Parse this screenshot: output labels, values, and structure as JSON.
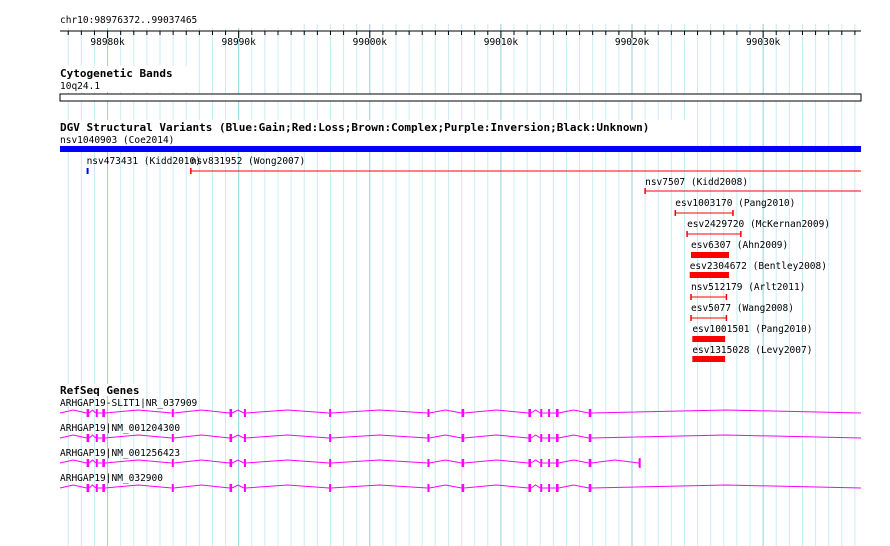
{
  "ruler": {
    "title": "chr10:98976372..99037465",
    "ticks": [
      {
        "label": "98980k",
        "pos": 98980000
      },
      {
        "label": "98990k",
        "pos": 98990000
      },
      {
        "label": "99000k",
        "pos": 99000000
      },
      {
        "label": "99010k",
        "pos": 99010000
      },
      {
        "label": "99020k",
        "pos": 99020000
      },
      {
        "label": "99030k",
        "pos": 99030000
      }
    ]
  },
  "cytoband": {
    "title": "Cytogenetic Bands",
    "band": "10q24.1"
  },
  "dgv": {
    "title": "DGV Structural Variants (Blue:Gain;Red:Loss;Brown:Complex;Purple:Inversion;Black:Unknown)",
    "colors": {
      "gain": "#0000ff",
      "loss": "#ff0000",
      "complex": "#996633",
      "inversion": "#9900cc",
      "unknown": "#000000"
    },
    "variants": [
      {
        "label": "nsv1040903 (Coe2014)",
        "type": "gain",
        "start": 98976372,
        "end": 99037465,
        "style": "block"
      },
      {
        "label": "nsv473431 (Kidd2010)",
        "type": "gain",
        "start": 98978400,
        "end": 98978550,
        "style": "tick"
      },
      {
        "label": "nsv831952 (Wong2007)",
        "type": "loss",
        "start": 98986350,
        "end": 99037465,
        "style": "line"
      },
      {
        "label": "nsv7507 (Kidd2008)",
        "type": "loss",
        "start": 99021000,
        "end": 99037465,
        "style": "line"
      },
      {
        "label": "esv1003170 (Pang2010)",
        "type": "loss",
        "start": 99023300,
        "end": 99027700,
        "style": "line"
      },
      {
        "label": "esv2429720 (McKernan2009)",
        "type": "loss",
        "start": 99024200,
        "end": 99028300,
        "style": "line"
      },
      {
        "label": "esv6307 (Ahn2009)",
        "type": "loss",
        "start": 99024500,
        "end": 99027400,
        "style": "block"
      },
      {
        "label": "esv2304672 (Bentley2008)",
        "type": "loss",
        "start": 99024400,
        "end": 99027400,
        "style": "block"
      },
      {
        "label": "nsv512179 (Arlt2011)",
        "type": "loss",
        "start": 99024500,
        "end": 99027200,
        "style": "line"
      },
      {
        "label": "esv5077 (Wang2008)",
        "type": "loss",
        "start": 99024500,
        "end": 99027200,
        "style": "line"
      },
      {
        "label": "esv1001501 (Pang2010)",
        "type": "loss",
        "start": 99024600,
        "end": 99027100,
        "style": "block"
      },
      {
        "label": "esv1315028 (Levy2007)",
        "type": "loss",
        "start": 99024600,
        "end": 99027100,
        "style": "block"
      }
    ]
  },
  "refseq": {
    "title": "RefSeq Genes",
    "color": "#ff00ff",
    "genes": [
      {
        "label": "ARHGAP19-SLIT1|NR_037909",
        "start": 98976372,
        "end": 99037465,
        "exons": [
          [
            98978400,
            98978600
          ],
          [
            98979100,
            98979250
          ],
          [
            98979600,
            98979800
          ],
          [
            98984900,
            98985050
          ],
          [
            98989300,
            98989500
          ],
          [
            98990400,
            98990550
          ],
          [
            98996900,
            98997050
          ],
          [
            99004400,
            99004550
          ],
          [
            99007000,
            99007200
          ],
          [
            99012100,
            99012300
          ],
          [
            99013000,
            99013150
          ],
          [
            99013600,
            99013750
          ],
          [
            99014200,
            99014400
          ],
          [
            99016700,
            99016900
          ]
        ]
      },
      {
        "label": "ARHGAP19|NM_001204300",
        "start": 98976372,
        "end": 99037465,
        "exons": [
          [
            98978400,
            98978600
          ],
          [
            98979100,
            98979250
          ],
          [
            98979600,
            98979800
          ],
          [
            98984900,
            98985050
          ],
          [
            98989300,
            98989500
          ],
          [
            98990400,
            98990550
          ],
          [
            98996900,
            98997050
          ],
          [
            99004400,
            99004550
          ],
          [
            99007000,
            99007200
          ],
          [
            99012100,
            99012300
          ],
          [
            99013000,
            99013150
          ],
          [
            99013600,
            99013750
          ],
          [
            99014200,
            99014400
          ],
          [
            99016700,
            99016900
          ]
        ]
      },
      {
        "label": "ARHGAP19|NM_001256423",
        "start": 98976372,
        "end": 99020600,
        "exons": [
          [
            98978400,
            98978600
          ],
          [
            98979100,
            98979250
          ],
          [
            98979600,
            98979800
          ],
          [
            98984900,
            98985050
          ],
          [
            98989300,
            98989500
          ],
          [
            98990400,
            98990550
          ],
          [
            98996900,
            98997050
          ],
          [
            99004400,
            99004550
          ],
          [
            99007000,
            99007200
          ],
          [
            99012100,
            99012300
          ],
          [
            99013000,
            99013150
          ],
          [
            99013600,
            99013750
          ],
          [
            99014200,
            99014400
          ],
          [
            99016700,
            99016900
          ],
          [
            99020500,
            99020600
          ]
        ]
      },
      {
        "label": "ARHGAP19|NM_032900",
        "start": 98976372,
        "end": 99037465,
        "exons": [
          [
            98978400,
            98978600
          ],
          [
            98979100,
            98979250
          ],
          [
            98979600,
            98979800
          ],
          [
            98984900,
            98985050
          ],
          [
            98989300,
            98989500
          ],
          [
            98990400,
            98990550
          ],
          [
            98996900,
            98997050
          ],
          [
            99004400,
            99004550
          ],
          [
            99007000,
            99007200
          ],
          [
            99012100,
            99012300
          ],
          [
            99013000,
            99013150
          ],
          [
            99013600,
            99013750
          ],
          [
            99014200,
            99014400
          ],
          [
            99016700,
            99016900
          ]
        ]
      }
    ]
  }
}
